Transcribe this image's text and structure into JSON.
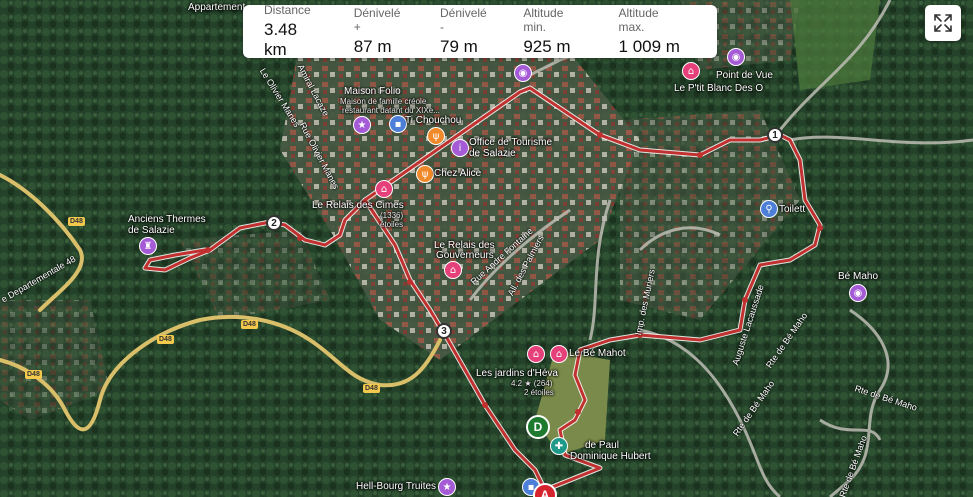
{
  "stats": [
    {
      "label": "Distance",
      "value": "3.48 km"
    },
    {
      "label": "Dénivelé +",
      "value": "87 m"
    },
    {
      "label": "Dénivelé -",
      "value": "79 m"
    },
    {
      "label": "Altitude min.",
      "value": "925 m"
    },
    {
      "label": "Altitude max.",
      "value": "1 009 m"
    }
  ],
  "colors": {
    "route": "#c0312f",
    "start": "#d6242f",
    "end": "#1e7a2e"
  },
  "places": {
    "appartement": "Appartement",
    "maison_folio": "Maison Folio",
    "maison_folio_sub1": "Maison de famille créole",
    "maison_folio_sub2": "restaurant datant du XIXe...",
    "ti_chouchou": "Ti Chouchou",
    "office_tourisme1": "Office de Tourisme",
    "office_tourisme2": "de Salazie",
    "chez_alice": "Chez Alice",
    "relais_cimes": "Le Relais des Cimes",
    "relais_cimes_rating": "(1336)",
    "relais_cimes_stars": "étoiles",
    "relais_gouv1": "Le Relais des",
    "relais_gouv2": "Gouverneurs",
    "anciens_thermes1": "Anciens Thermes",
    "anciens_thermes2": "de Salazie",
    "point_de_vue": "Point de Vue",
    "ptit_blanc": "Le P'tit Blanc Des O",
    "toilettes": "Toilett",
    "be_maho": "Bé Maho",
    "le_be_mahot": "Le Bé Mahot",
    "jardins_heva": "Les jardins d'Héva",
    "jardins_rating": "4.2 ★ (264)",
    "jardins_stars": "2 étoiles",
    "eglise1": "de Paul",
    "eglise2": "Dominique Hubert",
    "hell_bourg": "Hell-Bourg Truites"
  },
  "roads": {
    "d48": "D48",
    "dep48": "e Departementale 48",
    "amiral_lacaze": "Amiral Lacaze",
    "olivier_manes1": "Le Olivier Manes",
    "olivier_manes2": "Rue Olivier Manes",
    "andre_fontaine": "Rue Andre Fontaine",
    "palmiers": "All. des Palmiers",
    "muriers": "Imp. des Muriers",
    "lacaussade": "Auguste Lacaussade",
    "rte_be_maho": "Rte de Bé Maho"
  },
  "waypoints": [
    "1",
    "2",
    "3"
  ],
  "markers": {
    "start": "A",
    "end": "D"
  },
  "icons": {
    "fullscreen": "expand-icon"
  }
}
